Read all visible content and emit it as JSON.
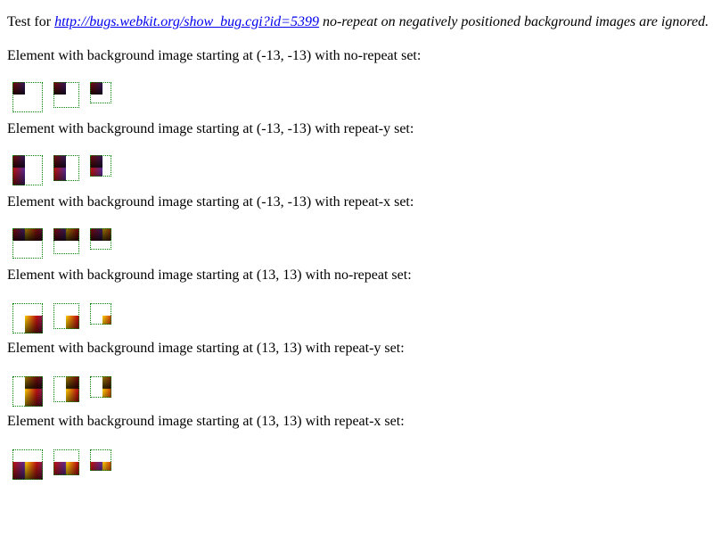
{
  "header": {
    "lead": "Test for ",
    "link_text": "http://bugs.webkit.org/show_bug.cgi?id=5399",
    "rest": " no-repeat on negatively positioned background images are ignored."
  },
  "sections": [
    {
      "label": "Element with background image starting at (-13, -13) with no-repeat set:",
      "offset": -13,
      "repeat": "no-repeat"
    },
    {
      "label": "Element with background image starting at (-13, -13) with repeat-y set:",
      "offset": -13,
      "repeat": "repeat-y"
    },
    {
      "label": "Element with background image starting at (-13, -13) with repeat-x set:",
      "offset": -13,
      "repeat": "repeat-x"
    },
    {
      "label": "Element with background image starting at (13, 13) with no-repeat set:",
      "offset": 13,
      "repeat": "no-repeat"
    },
    {
      "label": "Element with background image starting at (13, 13) with repeat-y set:",
      "offset": 13,
      "repeat": "repeat-y"
    },
    {
      "label": "Element with background image starting at (13, 13) with repeat-x set:",
      "offset": 13,
      "repeat": "repeat-x"
    }
  ],
  "colors": {
    "border": "#008000",
    "link": "#0000ee",
    "gradient_top_left": "#ffd000",
    "gradient_mid": "#c01010",
    "gradient_right": "#5a2a9a",
    "gradient_bottom": "#000000"
  }
}
